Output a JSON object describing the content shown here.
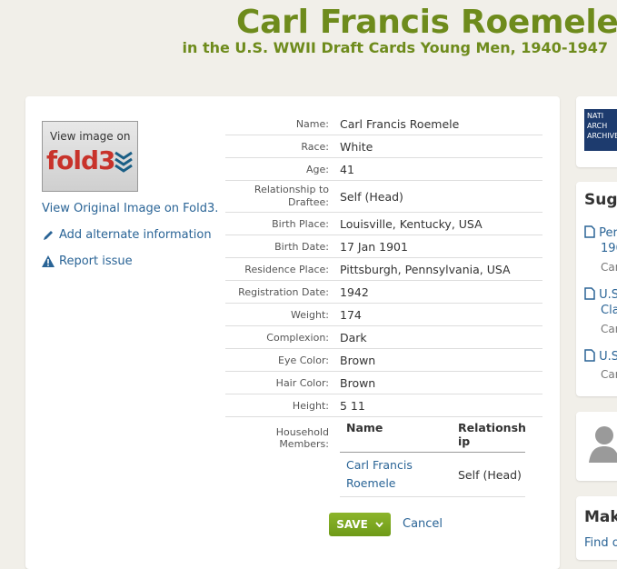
{
  "header": {
    "title": "Carl Francis Roemele",
    "subtitle": "in the U.S. WWII Draft Cards Young Men, 1940-1947"
  },
  "sidebar": {
    "fold3_caption": "View image on",
    "fold3_logo": "fold3",
    "view_original": "View Original Image on Fold3.",
    "add_alternate": "Add alternate information",
    "report_issue": "Report issue"
  },
  "record": {
    "fields": [
      {
        "label": "Name:",
        "value": "Carl Francis Roemele"
      },
      {
        "label": "Race:",
        "value": "White"
      },
      {
        "label": "Age:",
        "value": "41"
      },
      {
        "label": "Relationship to Draftee:",
        "value": "Self (Head)"
      },
      {
        "label": "Birth Place:",
        "value": "Louisville, Kentucky, USA"
      },
      {
        "label": "Birth Date:",
        "value": "17 Jan 1901"
      },
      {
        "label": "Residence Place:",
        "value": "Pittsburgh, Pennsylvania, USA"
      },
      {
        "label": "Registration Date:",
        "value": "1942"
      },
      {
        "label": "Weight:",
        "value": "174"
      },
      {
        "label": "Complexion:",
        "value": "Dark"
      },
      {
        "label": "Eye Color:",
        "value": "Brown"
      },
      {
        "label": "Hair Color:",
        "value": "Brown"
      },
      {
        "label": "Height:",
        "value": "5 11"
      }
    ],
    "household_label": "Household Members:",
    "household_headers": {
      "name": "Name",
      "relationship": "Relationsh ip"
    },
    "household_rows": [
      {
        "name": "Carl Francis Roemele",
        "relationship": "Self (Head)"
      }
    ]
  },
  "actions": {
    "save_label": "SAVE",
    "cancel_label": "Cancel"
  },
  "right": {
    "archives_text": "NATI ARCH ARCHIVE",
    "suggestions_title": "Sugg",
    "suggestions": [
      {
        "line1": "Per",
        "line2": "196",
        "sub": "Car"
      },
      {
        "line1": "U.S",
        "line2": "Cla",
        "sub": "Car"
      },
      {
        "line1": "U.S",
        "line2": "",
        "sub": "Car"
      }
    ],
    "make_title": "Make",
    "find_link": "Find o"
  },
  "colors": {
    "accent": "#6e8b1c",
    "link": "#2a6496",
    "save": "#7aa622",
    "fold3_red": "#c8332b"
  }
}
